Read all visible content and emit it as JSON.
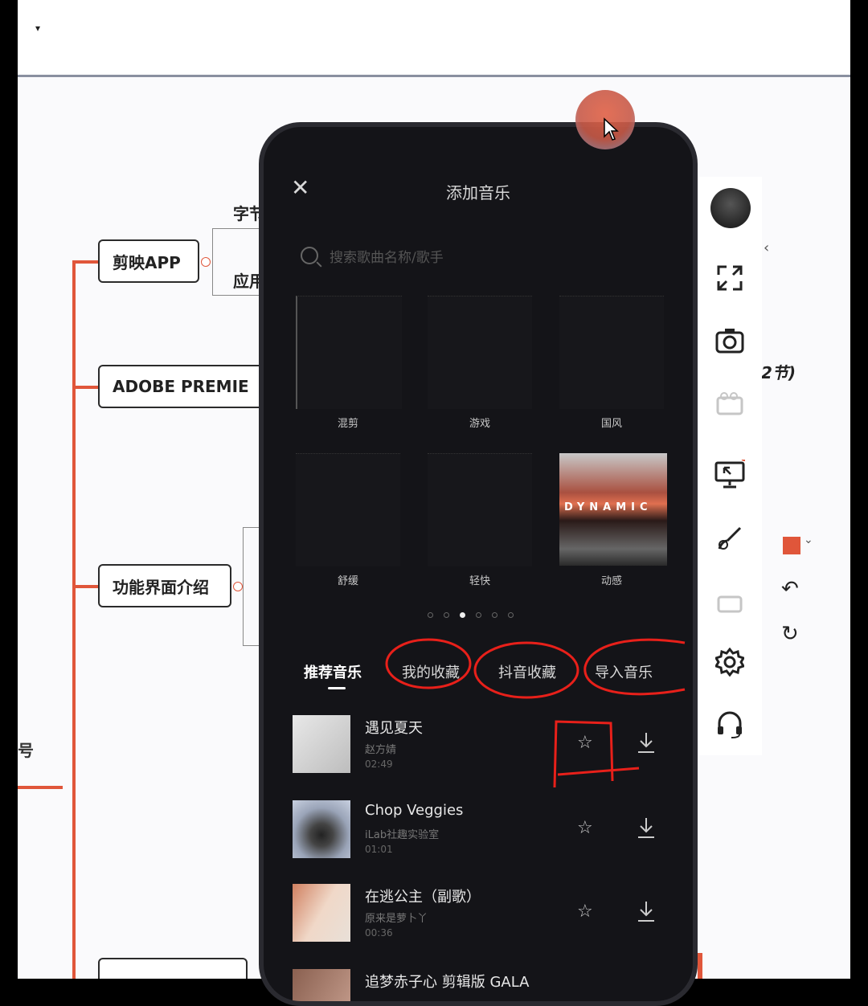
{
  "topbar": {
    "menu_caret": "▾"
  },
  "mindmap": {
    "node_jianying": "剪映APP",
    "node_adobe": "ADOBE    PREMIE",
    "node_function": "功能界面介绍",
    "label_zijie": "字节",
    "label_yingyong": "应用",
    "label_sections": "2节)"
  },
  "phone": {
    "title": "添加音乐",
    "close_icon": "✕",
    "search_placeholder": "搜索歌曲名称/歌手",
    "categories": [
      {
        "label": "混剪"
      },
      {
        "label": "游戏"
      },
      {
        "label": "国风"
      },
      {
        "label": "舒缓"
      },
      {
        "label": "轻快"
      },
      {
        "label": "动感",
        "cover_text": "DYNAMIC"
      }
    ],
    "pager": {
      "count": 6,
      "active_index": 2
    },
    "tabs": [
      {
        "label": "推荐音乐",
        "active": true
      },
      {
        "label": "我的收藏",
        "active": false
      },
      {
        "label": "抖音收藏",
        "active": false
      },
      {
        "label": "导入音乐",
        "active": false
      }
    ],
    "songs": [
      {
        "title": "遇见夏天",
        "artist": "赵方婧",
        "duration": "02:49"
      },
      {
        "title": "Chop Veggies",
        "artist": "iLab社趣实验室",
        "duration": "01:01"
      },
      {
        "title": "在逃公主（副歌）",
        "artist": "原来是萝卜丫",
        "duration": "00:36"
      },
      {
        "title": "追梦赤子心 剪辑版 GALA",
        "artist": "",
        "duration": ""
      }
    ]
  },
  "colors": {
    "accent": "#e0563a",
    "phone_bg": "#141418",
    "annotation": "#e8201a"
  }
}
